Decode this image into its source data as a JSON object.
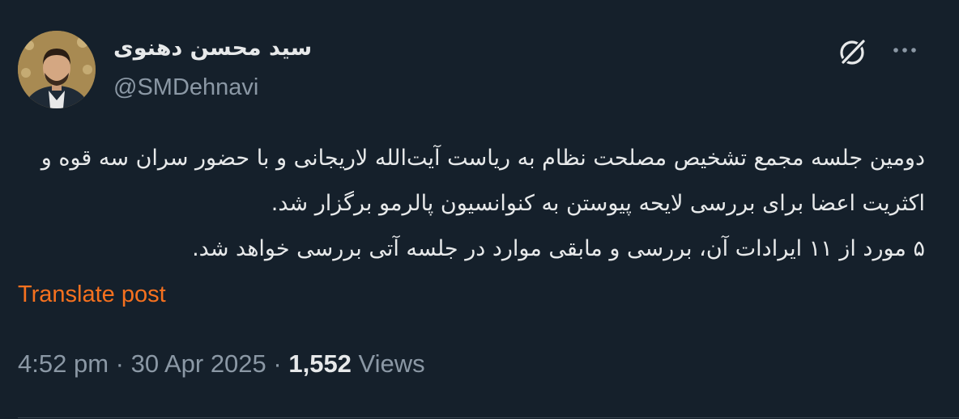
{
  "author": {
    "display_name": "سید محسن دهنوی",
    "handle": "@SMDehnavi",
    "avatar_icon": "profile-photo"
  },
  "actions": {
    "grok_icon": "grok-icon",
    "more_icon": "more-horizontal-icon"
  },
  "post": {
    "lines": [
      "دومین جلسه مجمع تشخیص مصلحت نظام به ریاست آیت‌الله لاریجانی و با حضور سران سه قوه و اکثریت اعضا برای بررسی لایحه پیوستن به کنوانسیون پالرمو برگزار شد.",
      "۵ مورد از ۱۱ ایرادات آن، بررسی و مابقی موارد در جلسه آتی بررسی خواهد شد."
    ],
    "translate_label": "Translate post"
  },
  "meta": {
    "time": "4:52 pm",
    "separator1": " · ",
    "date": "30 Apr 2025",
    "separator2": " · ",
    "views_count": "1,552",
    "views_label": " Views"
  },
  "colors": {
    "background": "#15202b",
    "text": "#e7e9ea",
    "secondary": "#8b98a5",
    "translate_link": "#f6711f"
  }
}
